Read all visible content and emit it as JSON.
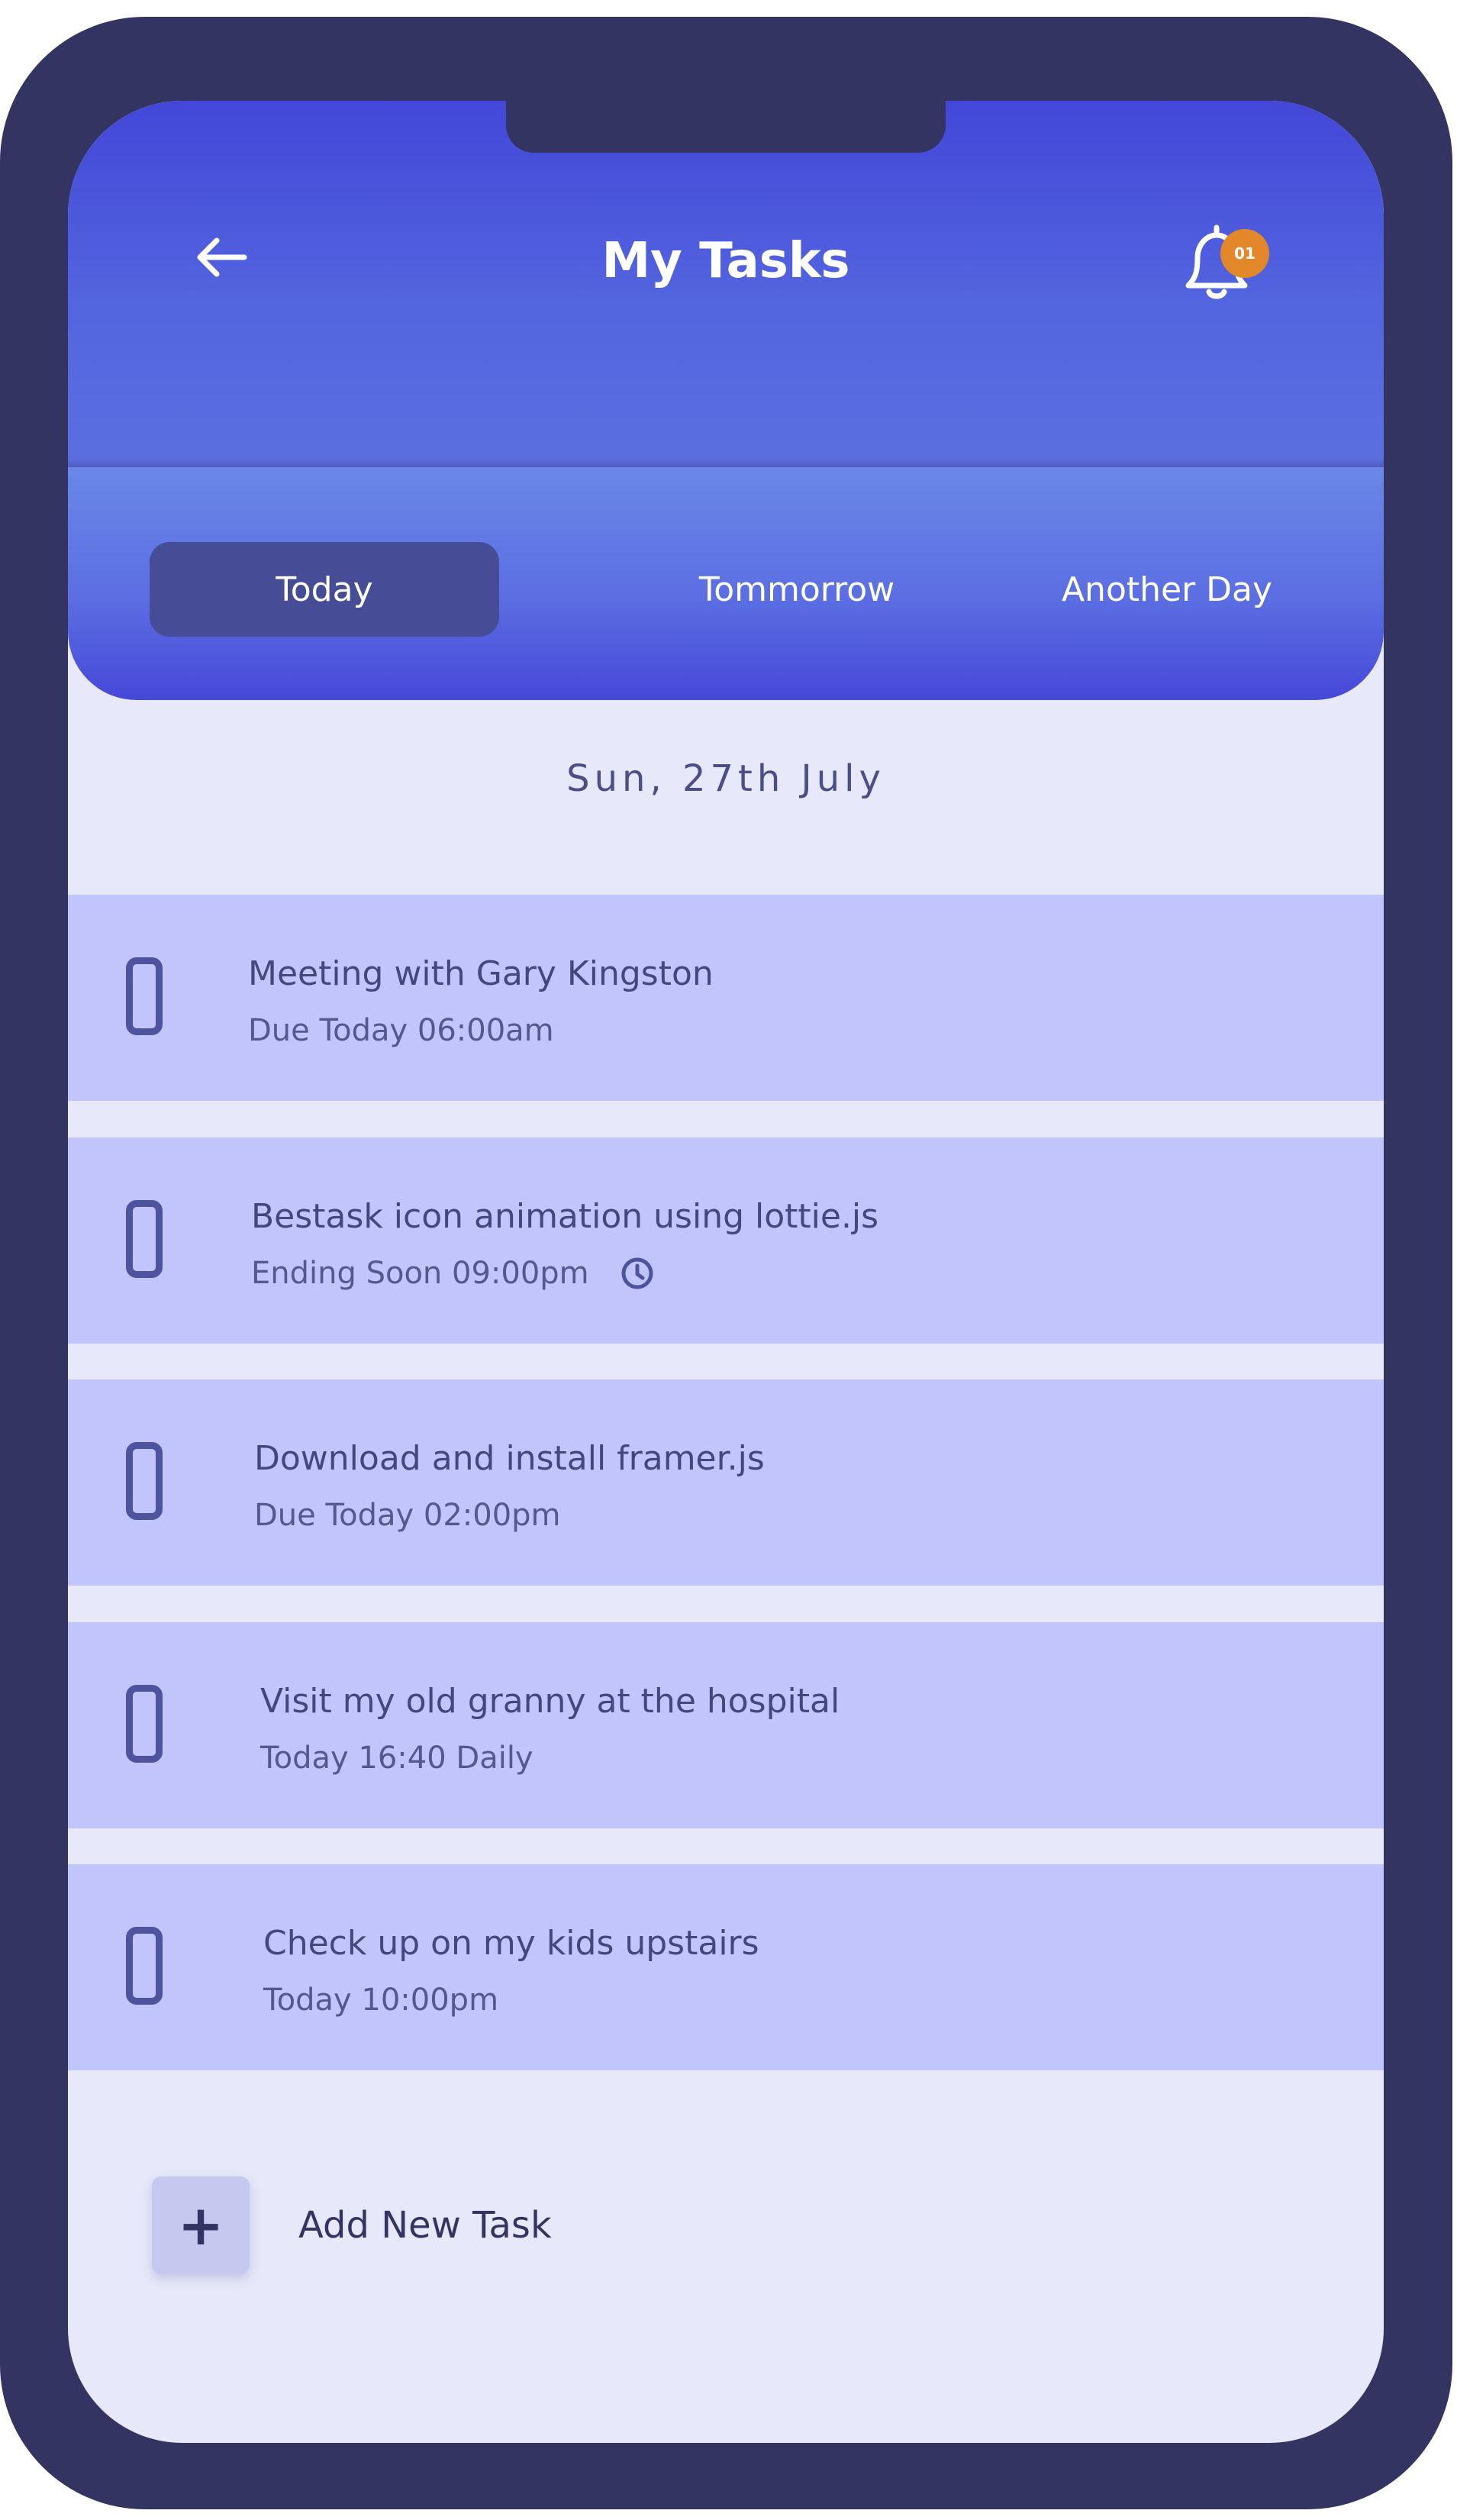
{
  "header": {
    "title": "My Tasks",
    "notification_badge": "01"
  },
  "tabs": [
    {
      "label": "Today",
      "active": true
    },
    {
      "label": "Tommorrow",
      "active": false
    },
    {
      "label": "Another Day",
      "active": false
    }
  ],
  "date_label": "Sun, 27th July",
  "tasks": [
    {
      "title": "Meeting with Gary Kingston",
      "subtitle": "Due Today 06:00am"
    },
    {
      "title": "Bestask icon animation using lottie.js",
      "subtitle": "Ending Soon 09:00pm",
      "icon": "clock-icon"
    },
    {
      "title": "Download and install framer.js",
      "subtitle": "Due Today 02:00pm"
    },
    {
      "title": "Visit my old granny at the hospital",
      "subtitle": "Today 16:40 Daily"
    },
    {
      "title": "Check up on my kids upstairs",
      "subtitle": "Today 10:00pm"
    }
  ],
  "add_task": {
    "icon": "+",
    "label": "Add New Task"
  },
  "colors": {
    "frame": "#343462",
    "header_top": "#4347d8",
    "header_bottom": "#5b6fe0",
    "active_tab": "#464d96",
    "screen_bg": "#e7e8fa",
    "task_bg": "#c1c5fc",
    "badge": "#e2882a",
    "text_dark": "#44477f"
  }
}
